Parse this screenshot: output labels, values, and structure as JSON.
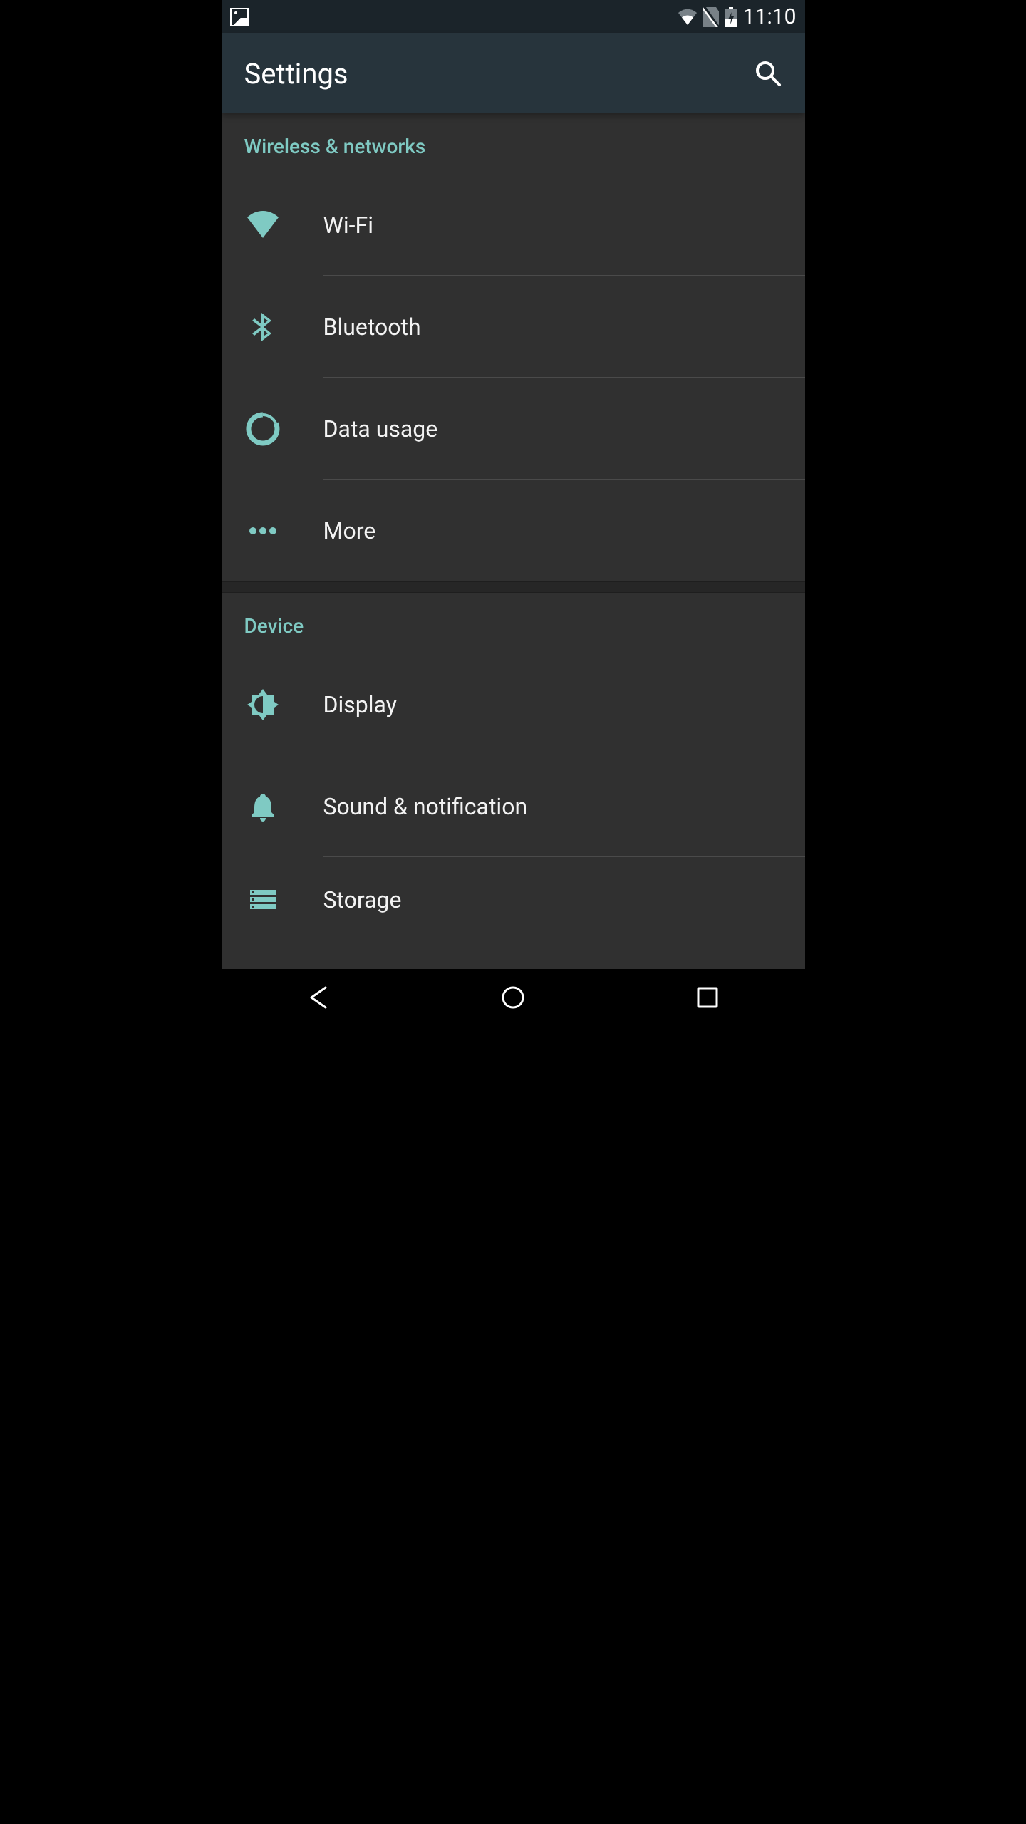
{
  "status": {
    "time": "11:10"
  },
  "appbar": {
    "title": "Settings"
  },
  "sections": [
    {
      "header": "Wireless & networks",
      "items": [
        {
          "icon": "wifi",
          "label": "Wi-Fi"
        },
        {
          "icon": "bluetooth",
          "label": "Bluetooth"
        },
        {
          "icon": "data-usage",
          "label": "Data usage"
        },
        {
          "icon": "more",
          "label": "More"
        }
      ]
    },
    {
      "header": "Device",
      "items": [
        {
          "icon": "display",
          "label": "Display"
        },
        {
          "icon": "sound",
          "label": "Sound & notification"
        },
        {
          "icon": "storage",
          "label": "Storage"
        }
      ]
    }
  ],
  "colors": {
    "accent": "#7fcac3",
    "headerbg": "#27343c",
    "statusbg": "#1b242a",
    "contentbg": "#303030",
    "icon": "#7fcac3",
    "text": "#f3f3f3"
  }
}
